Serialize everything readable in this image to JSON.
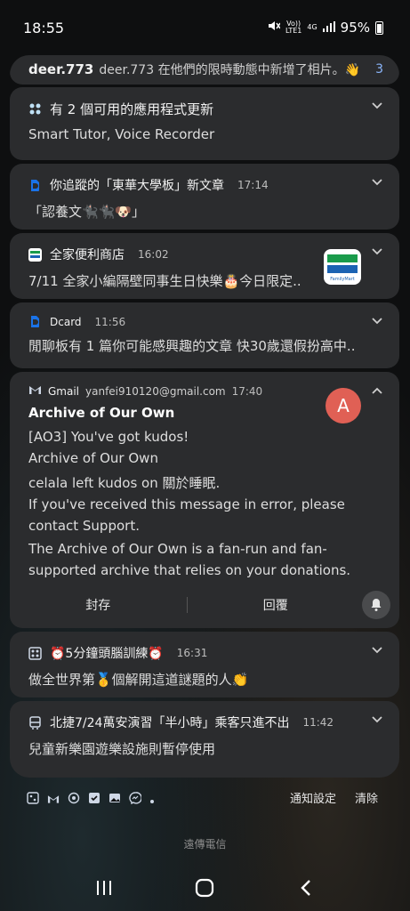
{
  "status_bar": {
    "time": "18:55",
    "volte": "Vo))",
    "lte": "LTE1",
    "network": "4G",
    "battery": "95%"
  },
  "notifications": [
    {
      "id": "instagram",
      "sender": "deer.773",
      "text": "deer.773 在他們的限時動態中新增了相片。👋",
      "count": "3"
    },
    {
      "id": "updates",
      "title": "有 2 個可用的應用程式更新",
      "body": "Smart Tutor, Voice Recorder"
    },
    {
      "id": "dcard-follow",
      "title": "你追蹤的「東華大學板」新文章",
      "time": "17:14",
      "body": "「認養文🐈‍⬛🐈‍⬛🐶」"
    },
    {
      "id": "familymart",
      "title": "全家便利商店",
      "time": "16:02",
      "body": "7/11 全家小編隔壁同事生日快樂🎂今日限定..",
      "logo_text": "FamilyMart"
    },
    {
      "id": "dcard",
      "title": "Dcard",
      "time": "11:56",
      "body": "閒聊板有 1 篇你可能感興趣的文章 快30歲還假扮高中.."
    },
    {
      "id": "gmail",
      "app": "Gmail",
      "account": "yanfei910120@gmail.com",
      "time": "17:40",
      "avatar_letter": "A",
      "sender": "Archive of Our Own",
      "subject": "[AO3] You've got kudos!",
      "line1": "Archive of Our Own",
      "line2": "celala left kudos on 關於睡眠.",
      "line3": "If you've received this message in error, please contact Support.",
      "line4": "The Archive of Our Own is a fan-run and fan-supported archive that relies on your donations.",
      "action_archive": "封存",
      "action_reply": "回覆"
    },
    {
      "id": "brain",
      "title": "⏰5分鐘頭腦訓練⏰",
      "time": "16:31",
      "body": "做全世界第🥇個解開這道謎題的人👏"
    },
    {
      "id": "news",
      "title": "北捷7/24萬安演習「半小時」乘客只進不出",
      "time": "11:42",
      "body": "兒童新樂園遊樂設施則暫停使用"
    }
  ],
  "footer": {
    "settings_label": "通知設定",
    "clear_label": "清除",
    "carrier": "遠傳電信"
  },
  "colors": {
    "card_bg": "#2b2c2e",
    "avatar": "#e06055",
    "dcard_blue": "#1a73e8"
  }
}
